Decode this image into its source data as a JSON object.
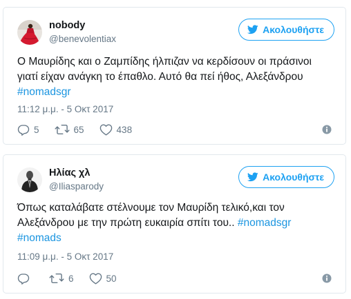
{
  "tweets": [
    {
      "name": "nobody",
      "handle": "@benevolentiax",
      "follow_label": "Ακολουθήστε",
      "text_lines": [
        "Ο Μαυρίδης και ο Ζαμπίδης ήλπιζαν να κερδίσουν οι πράσινοι",
        "γιατί είχαν ανάγκη το έπαθλο. Αυτό θα πεί ήθος, Αλεξάνδρου"
      ],
      "hashtags": [
        "#nomadsgr"
      ],
      "timestamp": "11:12 μ.μ. - 5 Οκτ 2017",
      "replies": "5",
      "retweets": "65",
      "likes": "438",
      "avatar_icon": "red-dress-avatar"
    },
    {
      "name": "Ηλίας χλ",
      "handle": "@Iliasparody",
      "follow_label": "Ακολουθήστε",
      "text_line1": "Όπως καταλάβατε στέλνουμε τον Μαυρίδη τελικό,και τον",
      "text_line2_prefix": "Αλεξάνδρου με την πρώτη ευκαιρία σπίτι του.. ",
      "hashtags": [
        "#nomadsgr",
        "#nomads"
      ],
      "timestamp": "11:09 μ.μ. - 5 Οκτ 2017",
      "replies": "",
      "retweets": "6",
      "likes": "50",
      "avatar_icon": "man-in-suit-avatar"
    }
  ],
  "colors": {
    "accent": "#1da1f2",
    "hashtag": "#1b95e0",
    "muted": "#657786",
    "border": "#e1e8ed"
  },
  "icons": {
    "follow": "twitter-bird-icon",
    "reply": "reply-icon",
    "retweet": "retweet-icon",
    "like": "heart-icon",
    "info": "info-icon"
  }
}
